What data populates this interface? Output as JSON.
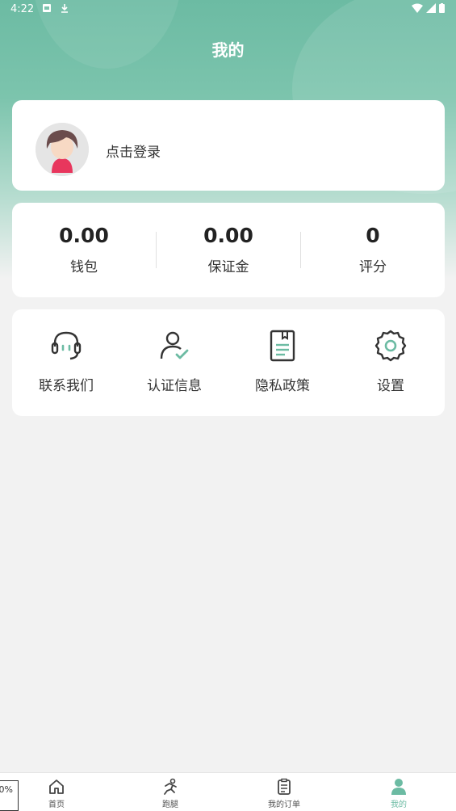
{
  "status_bar": {
    "time": "4:22"
  },
  "header": {
    "title": "我的"
  },
  "profile": {
    "login_label": "点击登录"
  },
  "stats": [
    {
      "value": "0.00",
      "label": "钱包"
    },
    {
      "value": "0.00",
      "label": "保证金"
    },
    {
      "value": "0",
      "label": "评分"
    }
  ],
  "menu": [
    {
      "label": "联系我们",
      "icon": "headset-icon"
    },
    {
      "label": "认证信息",
      "icon": "user-verified-icon"
    },
    {
      "label": "隐私政策",
      "icon": "document-icon"
    },
    {
      "label": "设置",
      "icon": "gear-icon"
    }
  ],
  "tabbar": [
    {
      "label": "首页",
      "icon": "home-icon"
    },
    {
      "label": "跑腿",
      "icon": "runner-icon"
    },
    {
      "label": "我的订单",
      "icon": "clipboard-icon"
    },
    {
      "label": "我的",
      "icon": "person-icon",
      "active": true
    }
  ],
  "edge_badge": "0%",
  "colors": {
    "accent": "#6cbba3",
    "avatar_bg": "#e5e5e5",
    "avatar_body": "#e8365d"
  }
}
